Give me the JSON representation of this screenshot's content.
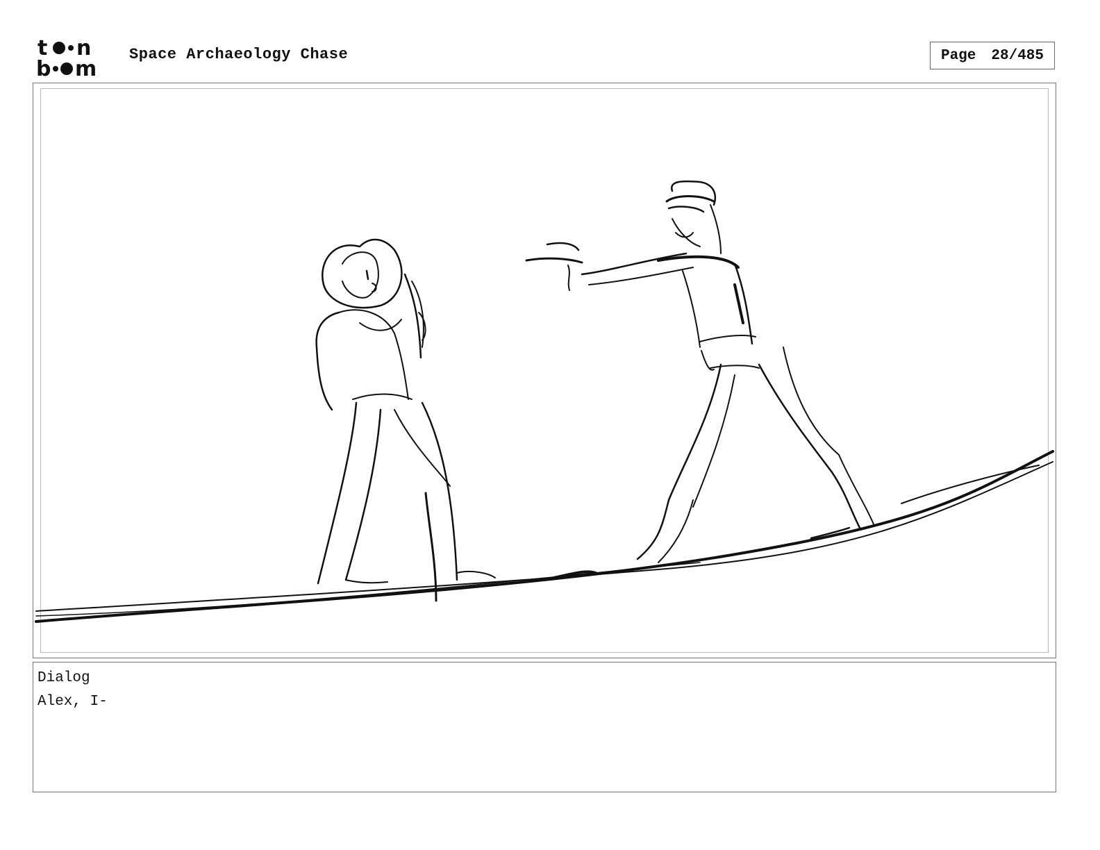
{
  "header": {
    "logo_line1": "toon",
    "logo_line2": "boom",
    "title": "Space Archaeology Chase",
    "page_label": "Page",
    "page_number": "28/485"
  },
  "panel": {
    "icon": "sketch-drawing"
  },
  "dialog": {
    "label": "Dialog",
    "text": "Alex, I-"
  }
}
